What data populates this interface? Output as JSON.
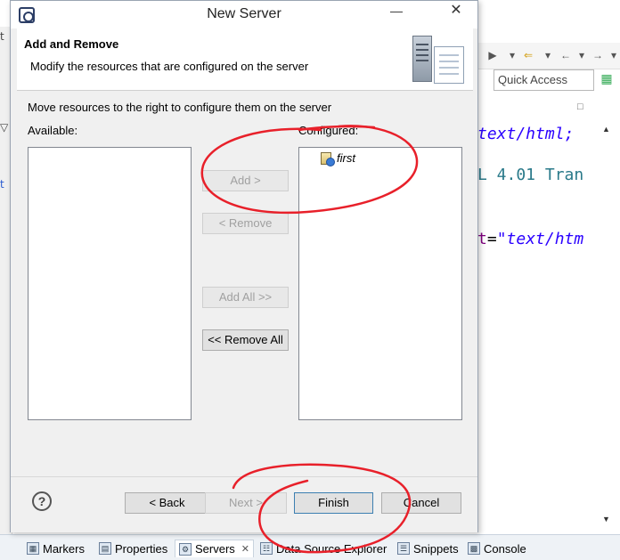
{
  "ide": {
    "left_strip": [
      "t",
      "",
      "",
      "▽",
      "",
      "t"
    ],
    "quick_access_placeholder": "Quick Access",
    "code_lines": [
      "text/html;",
      "L 4.01 Tran",
      {
        "attr": "t",
        "eq": "=",
        "str": "\"text/htm"
      }
    ]
  },
  "bottom_tabs": [
    {
      "label": "Markers",
      "icon": "markers-icon"
    },
    {
      "label": "Properties",
      "icon": "properties-icon"
    },
    {
      "label": "Servers",
      "icon": "servers-icon",
      "active": true
    },
    {
      "label": "Data Source Explorer",
      "icon": "data-source-icon"
    },
    {
      "label": "Snippets",
      "icon": "snippets-icon"
    },
    {
      "label": "Console",
      "icon": "console-icon"
    }
  ],
  "dialog": {
    "title": "New Server",
    "header": {
      "title": "Add and Remove",
      "description": "Modify the resources that are configured on the server"
    },
    "instruction": "Move resources to the right to configure them on the server",
    "available_label": "Available:",
    "configured_label": "Configured:",
    "available_items": [],
    "configured_items": [
      {
        "label": "first",
        "icon": "web-module-icon"
      }
    ],
    "buttons": {
      "add": "Add >",
      "remove": "< Remove",
      "add_all": "Add All >>",
      "remove_all": "<< Remove All",
      "help": "?",
      "back": "< Back",
      "next": "Next >",
      "finish": "Finish",
      "cancel": "Cancel"
    },
    "window_controls": {
      "minimize": "—",
      "close": "✕"
    }
  },
  "annotation_color": "#e8202a"
}
